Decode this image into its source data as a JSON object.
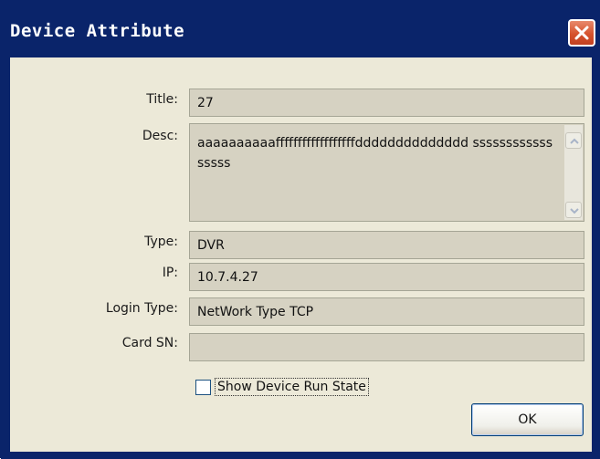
{
  "window": {
    "title": "Device Attribute"
  },
  "fields": {
    "title": {
      "label": "Title:",
      "value": "27"
    },
    "desc": {
      "label": "Desc:",
      "value": "aaaaaaaaaaffffffffffffffffffdddddddddddddd sssssssssssssssss"
    },
    "type": {
      "label": "Type:",
      "value": "DVR"
    },
    "ip": {
      "label": "IP:",
      "value": "10.7.4.27"
    },
    "login_type": {
      "label": "Login Type:",
      "value": "NetWork Type TCP"
    },
    "card_sn": {
      "label": "Card SN:",
      "value": ""
    }
  },
  "options": {
    "show_run_state_label": "Show Device Run State",
    "show_run_state_checked": false
  },
  "buttons": {
    "ok_label": "OK"
  },
  "icons": {
    "close": "close-icon",
    "scroll_up": "chevron-up-icon",
    "scroll_down": "chevron-down-icon"
  }
}
